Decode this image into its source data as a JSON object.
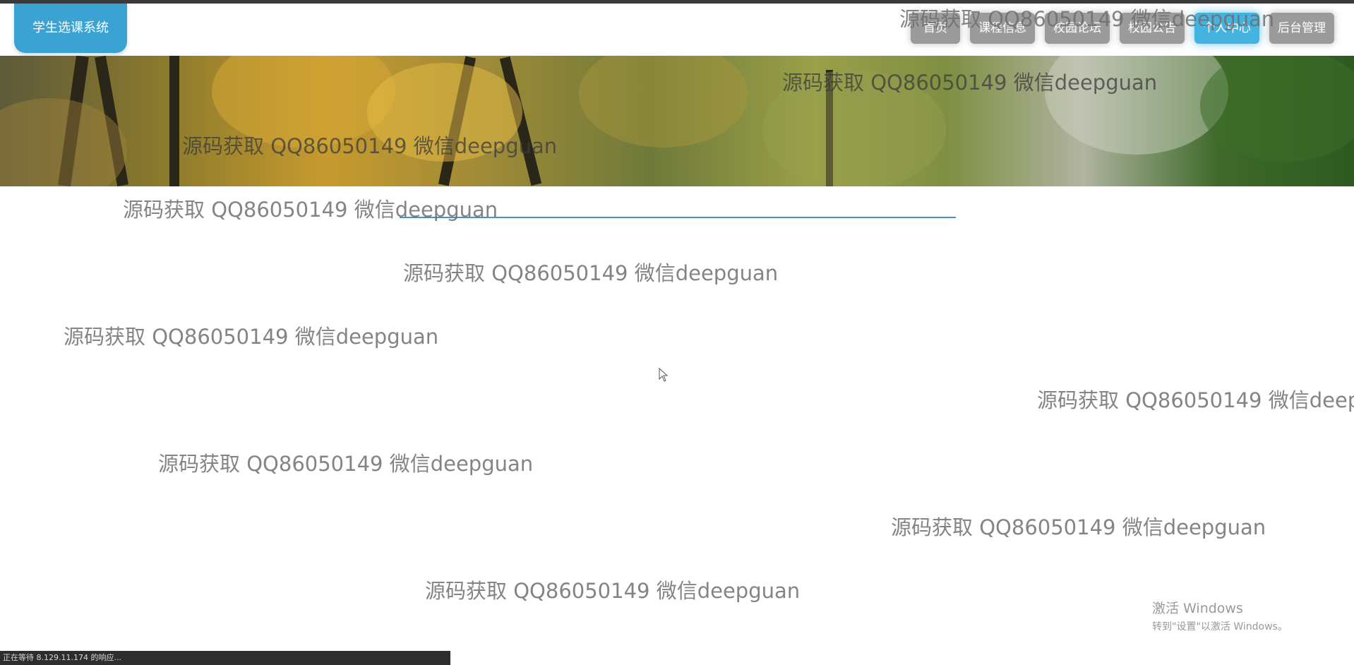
{
  "app": {
    "logo_text": "学生选课系统"
  },
  "nav": {
    "items": [
      {
        "label": "首页",
        "active": false
      },
      {
        "label": "课程信息",
        "active": false
      },
      {
        "label": "校园论坛",
        "active": false
      },
      {
        "label": "校园公告",
        "active": false
      },
      {
        "label": "个人中心",
        "active": true
      },
      {
        "label": "后台管理",
        "active": false
      }
    ]
  },
  "watermark_text": "源码获取 QQ86050149 微信deepguan",
  "os_overlay": {
    "activate_title": "激活 Windows",
    "activate_subtitle": "转到\"设置\"以激活 Windows。"
  },
  "browser": {
    "status_text": "正在等待 8.129.11.174 的响应..."
  },
  "colors": {
    "accent": "#45b3e0",
    "logo_bg": "#3aa3d4",
    "nav_bg": "#9b9b9b"
  }
}
